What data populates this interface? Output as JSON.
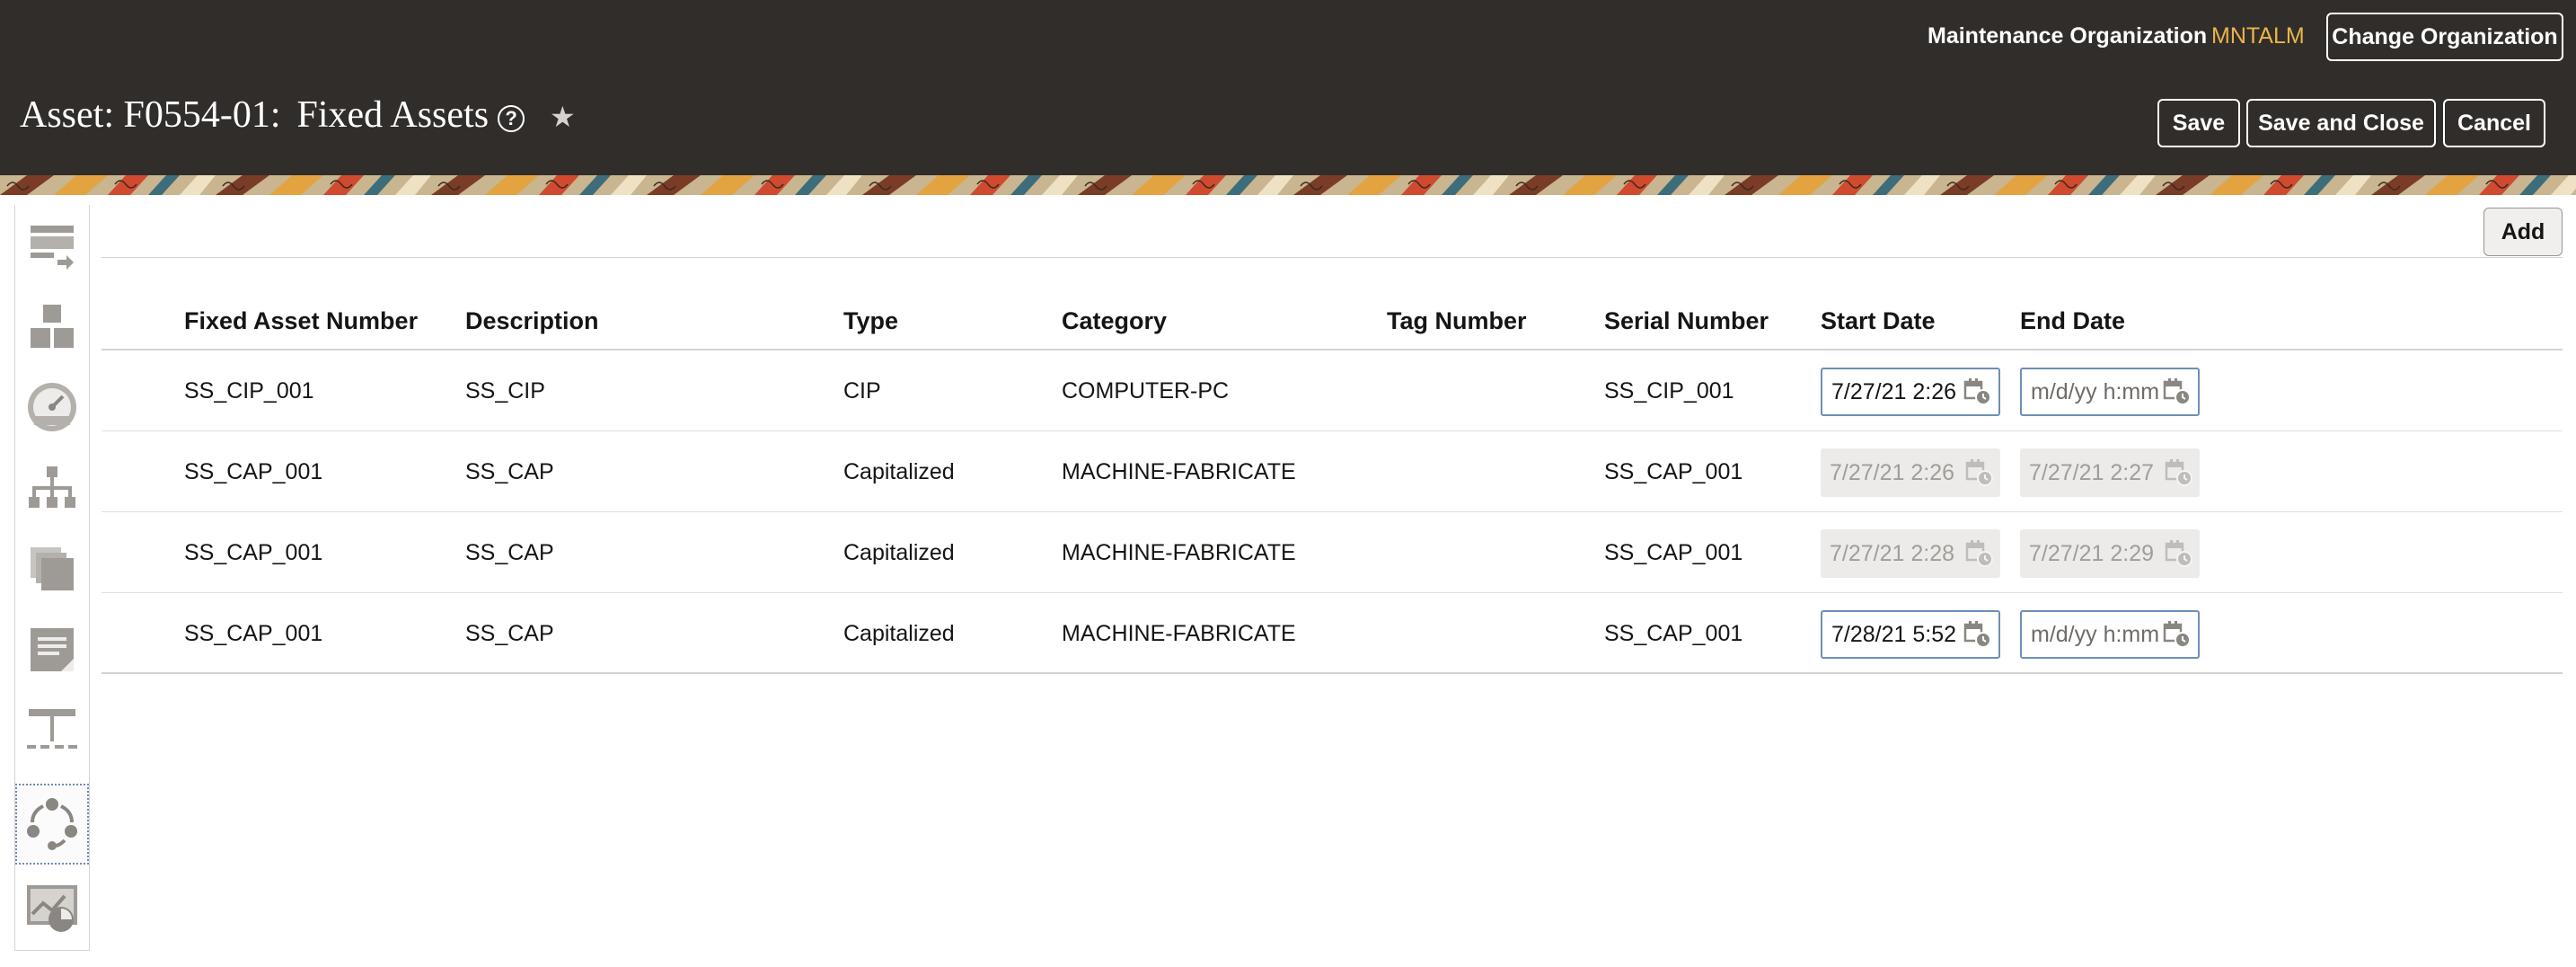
{
  "header": {
    "org_label": "Maintenance Organization",
    "org_value": "MNTALM",
    "change_org_label": "Change Organization",
    "title_prefix": "Asset: F0554-01:",
    "title_name": "Fixed Assets",
    "help_glyph": "?",
    "favorite_glyph": "★",
    "buttons": {
      "save": "Save",
      "save_close": "Save and Close",
      "cancel": "Cancel"
    }
  },
  "sidebar": {
    "items": [
      {
        "icon": "basic-info-icon"
      },
      {
        "icon": "structure-icon"
      },
      {
        "icon": "meter-icon"
      },
      {
        "icon": "hierarchy-icon"
      },
      {
        "icon": "documents-icon"
      },
      {
        "icon": "notes-icon"
      },
      {
        "icon": "relationships-icon"
      },
      {
        "icon": "lifecycle-icon",
        "active": true
      },
      {
        "icon": "analytics-icon"
      }
    ]
  },
  "toolbar": {
    "add_label": "Add"
  },
  "table": {
    "columns": [
      "Fixed Asset Number",
      "Description",
      "Type",
      "Category",
      "Tag Number",
      "Serial Number",
      "Start Date",
      "End Date"
    ],
    "rows": [
      {
        "number": "SS_CIP_001",
        "description": "SS_CIP",
        "type": "CIP",
        "category": "COMPUTER-PC",
        "tag": "",
        "serial": "SS_CIP_001",
        "start": "7/27/21 2:26",
        "start_readonly": false,
        "end": "",
        "end_placeholder": "m/d/yy h:mm",
        "end_readonly": false
      },
      {
        "number": "SS_CAP_001",
        "description": "SS_CAP",
        "type": "Capitalized",
        "category": "MACHINE-FABRICATE",
        "tag": "",
        "serial": "SS_CAP_001",
        "start": "7/27/21 2:26",
        "start_readonly": true,
        "end": "7/27/21 2:27",
        "end_placeholder": "",
        "end_readonly": true
      },
      {
        "number": "SS_CAP_001",
        "description": "SS_CAP",
        "type": "Capitalized",
        "category": "MACHINE-FABRICATE",
        "tag": "",
        "serial": "SS_CAP_001",
        "start": "7/27/21 2:28",
        "start_readonly": true,
        "end": "7/27/21 2:29",
        "end_placeholder": "",
        "end_readonly": true
      },
      {
        "number": "SS_CAP_001",
        "description": "SS_CAP",
        "type": "Capitalized",
        "category": "MACHINE-FABRICATE",
        "tag": "",
        "serial": "SS_CAP_001",
        "start": "7/28/21 5:52",
        "start_readonly": false,
        "end": "",
        "end_placeholder": "m/d/yy h:mm",
        "end_readonly": false
      }
    ]
  },
  "colors": {
    "header_bg": "#312d2a",
    "org_value": "#e9b54a",
    "input_border": "#6d8fb8",
    "readonly_bg": "#ecebea"
  }
}
